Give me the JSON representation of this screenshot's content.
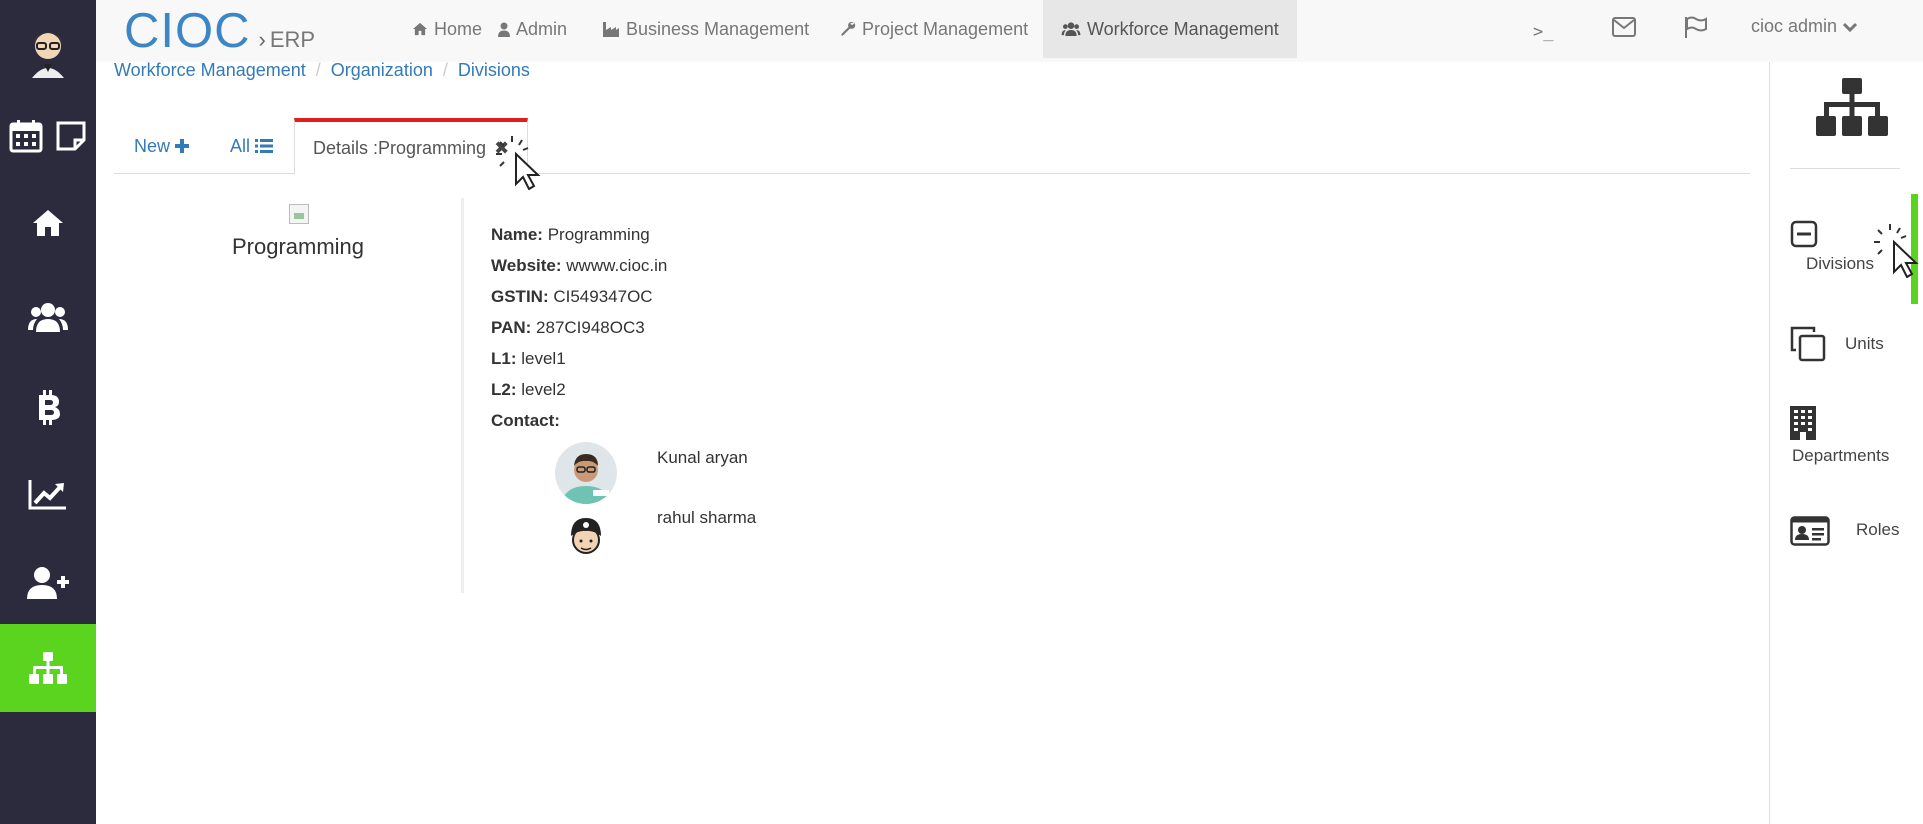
{
  "brand": {
    "main": "CIOC",
    "separator": "›",
    "sub": "ERP"
  },
  "topnav": {
    "items": [
      {
        "label": "Home",
        "icon": "home-icon"
      },
      {
        "label": "Admin",
        "icon": "user-icon"
      },
      {
        "label": "Business Management",
        "icon": "industry-icon"
      },
      {
        "label": "Project Management",
        "icon": "wrench-icon"
      },
      {
        "label": "Workforce Management",
        "icon": "users-icon",
        "active": true
      }
    ],
    "user_label": "cioc admin"
  },
  "breadcrumb": [
    "Workforce Management",
    "Organization",
    "Divisions"
  ],
  "tabs": {
    "new_label": "New",
    "all_label": "All",
    "details_label": "Details :Programming",
    "active_border_color": "#e21d1d"
  },
  "division": {
    "title": "Programming",
    "fields": [
      {
        "label": "Name:",
        "value": "Programming"
      },
      {
        "label": "Website:",
        "value": "wwww.cioc.in"
      },
      {
        "label": "GSTIN:",
        "value": "CI549347OC"
      },
      {
        "label": "PAN:",
        "value": "287CI948OC3"
      },
      {
        "label": "L1:",
        "value": "level1"
      },
      {
        "label": "L2:",
        "value": "level2"
      }
    ],
    "contact_label": "Contact:",
    "contacts": [
      {
        "name": "Kunal aryan"
      },
      {
        "name": "rahul sharma"
      }
    ]
  },
  "rightpanel": {
    "items": [
      {
        "label": "Divisions",
        "icon": "minus-square-icon",
        "active": true
      },
      {
        "label": "Units",
        "icon": "clone-icon"
      },
      {
        "label": "Departments",
        "icon": "building-icon"
      },
      {
        "label": "Roles",
        "icon": "id-card-icon"
      }
    ],
    "accent_color": "#5ad41e"
  },
  "colors": {
    "sidebar": "#2b2b3d",
    "accent_green": "#5ad41e",
    "link": "#337ab7",
    "brand": "#3d86c6"
  }
}
